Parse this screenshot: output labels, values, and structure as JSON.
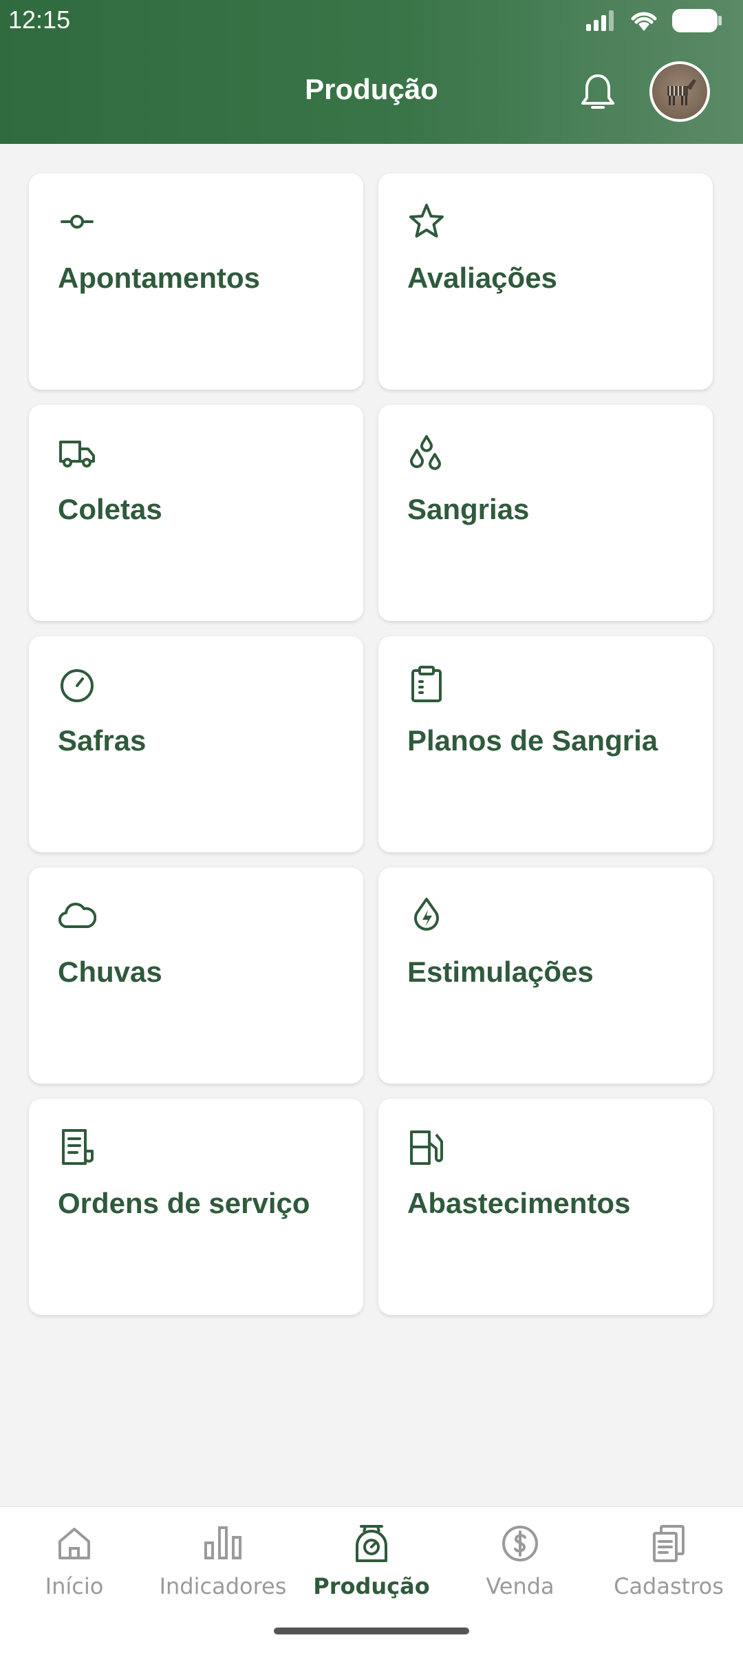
{
  "status_bar": {
    "time": "12:15"
  },
  "header": {
    "title": "Produção"
  },
  "menu": [
    {
      "label": "Apontamentos",
      "icon": "commit-icon"
    },
    {
      "label": "Avaliações",
      "icon": "star-icon"
    },
    {
      "label": "Coletas",
      "icon": "truck-icon"
    },
    {
      "label": "Sangrias",
      "icon": "droplets-icon"
    },
    {
      "label": "Safras",
      "icon": "gauge-icon"
    },
    {
      "label": "Planos de Sangria",
      "icon": "clipboard-icon"
    },
    {
      "label": "Chuvas",
      "icon": "cloud-icon"
    },
    {
      "label": "Estimulações",
      "icon": "drop-bolt-icon"
    },
    {
      "label": "Ordens de serviço",
      "icon": "receipt-icon"
    },
    {
      "label": "Abastecimentos",
      "icon": "fuel-icon"
    }
  ],
  "bottom_nav": [
    {
      "label": "Início",
      "icon": "home-icon",
      "active": false
    },
    {
      "label": "Indicadores",
      "icon": "bar-chart-icon",
      "active": false
    },
    {
      "label": "Produção",
      "icon": "scale-icon",
      "active": true
    },
    {
      "label": "Venda",
      "icon": "dollar-circle-icon",
      "active": false
    },
    {
      "label": "Cadastros",
      "icon": "documents-icon",
      "active": false
    }
  ],
  "colors": {
    "header_green": "#2f6b3e",
    "accent": "#2f5a3c",
    "inactive": "#9a9a9a",
    "background": "#f3f3f3"
  }
}
